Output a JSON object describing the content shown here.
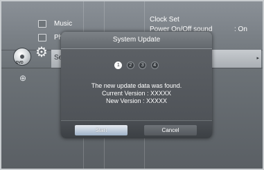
{
  "sidebar": {
    "items": [
      {
        "label": "Music",
        "icon": "music-icon"
      },
      {
        "label": "Ph",
        "icon": "photo-icon"
      },
      {
        "label": "Se",
        "icon": "gear-icon"
      }
    ],
    "disc_label": "DVD"
  },
  "settings": {
    "clock_set": "Clock Set",
    "power_sound_label": "Power On/Off sound",
    "power_sound_value": ": On"
  },
  "dialog": {
    "title": "System Update",
    "steps": [
      "1",
      "2",
      "3",
      "4"
    ],
    "active_step": 1,
    "message_line1": "The new update data was found.",
    "message_line2": "Current Version : XXXXX",
    "message_line3": "New Version : XXXXX",
    "start_label": "Start",
    "cancel_label": "Cancel"
  },
  "colors": {
    "background": "#6c7277",
    "dialog": "#55595e",
    "highlight": "#b9bec2",
    "start_button": "#c9d5e2"
  }
}
